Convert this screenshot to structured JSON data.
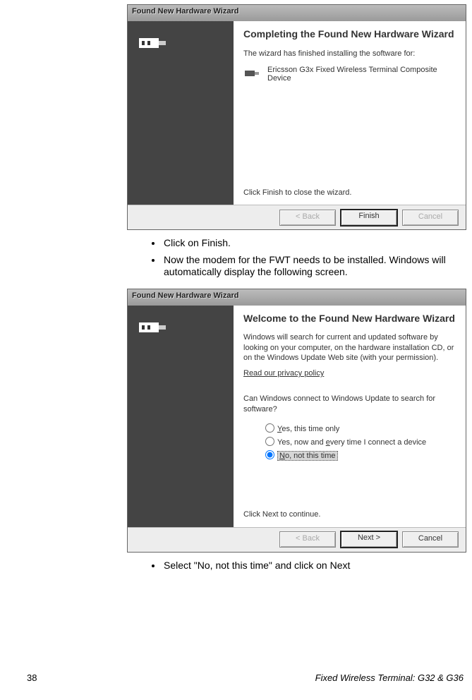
{
  "wizard1": {
    "title": "Found New Hardware Wizard",
    "heading": "Completing the Found New Hardware Wizard",
    "line1": "The wizard has finished installing the software for:",
    "device": "Ericsson G3x Fixed Wireless Terminal Composite Device",
    "finish_line": "Click Finish to close the wizard.",
    "btn_back": "< Back",
    "btn_finish": "Finish",
    "btn_cancel": "Cancel"
  },
  "bullets1": {
    "a": "Click on Finish.",
    "b": "Now the modem for the FWT needs to be installed. Windows will automatically display the following screen."
  },
  "wizard2": {
    "title": "Found New Hardware Wizard",
    "heading": "Welcome to the Found New Hardware Wizard",
    "intro": "Windows will search for current and updated software by looking on your computer, on the hardware installation CD, or on the Windows Update Web site (with your permission).",
    "privacy": "Read our privacy policy",
    "question": "Can Windows connect to Windows Update to search for software?",
    "opt1": "Yes, this time only",
    "opt2": "Yes, now and every time I connect a device",
    "opt3": "No, not this time",
    "continue_line": "Click Next to continue.",
    "btn_back": "< Back",
    "btn_next": "Next >",
    "btn_cancel": "Cancel"
  },
  "bullets2": {
    "a": "Select \"No, not this time\" and click on Next"
  },
  "footer": {
    "page": "38",
    "book": "Fixed Wireless Terminal: G32 & G36"
  }
}
